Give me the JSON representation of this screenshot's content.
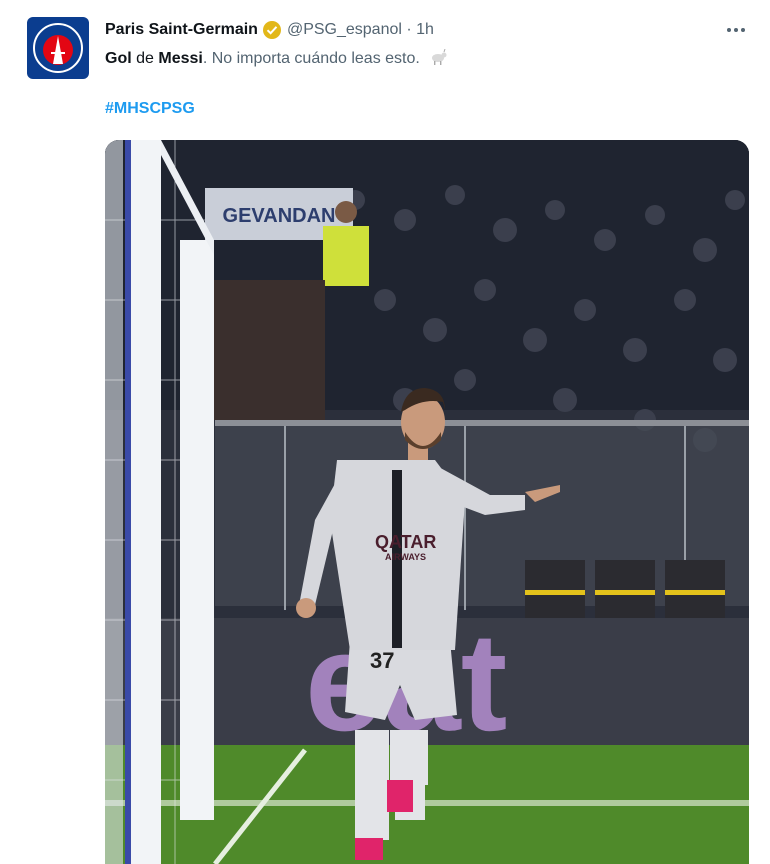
{
  "tweet": {
    "author_name": "Paris Saint-Germain",
    "handle_time": "@PSG_espanol · 1h",
    "text_bold_1": "Gol",
    "text_mid": " de ",
    "text_bold_2": "Messi",
    "text_rest": ". No importa cuándo leas esto.",
    "hashtag": "#MHSCPSG",
    "avatar_label": "PARIS",
    "icons": [
      "psg-logo",
      "verified-badge",
      "more-options",
      "goat-emoji"
    ]
  },
  "photo": {
    "banner_text": "GEVANDAN",
    "ad_board_text": "eat",
    "shirt_sponsor_line1": "QATAR",
    "shirt_sponsor_line2": "AIRWAYS",
    "shirt_number": "37"
  },
  "colors": {
    "brand_blue": "#0b3d8f",
    "link_blue": "#1d9bf0",
    "verified_gold": "#e2b719"
  }
}
